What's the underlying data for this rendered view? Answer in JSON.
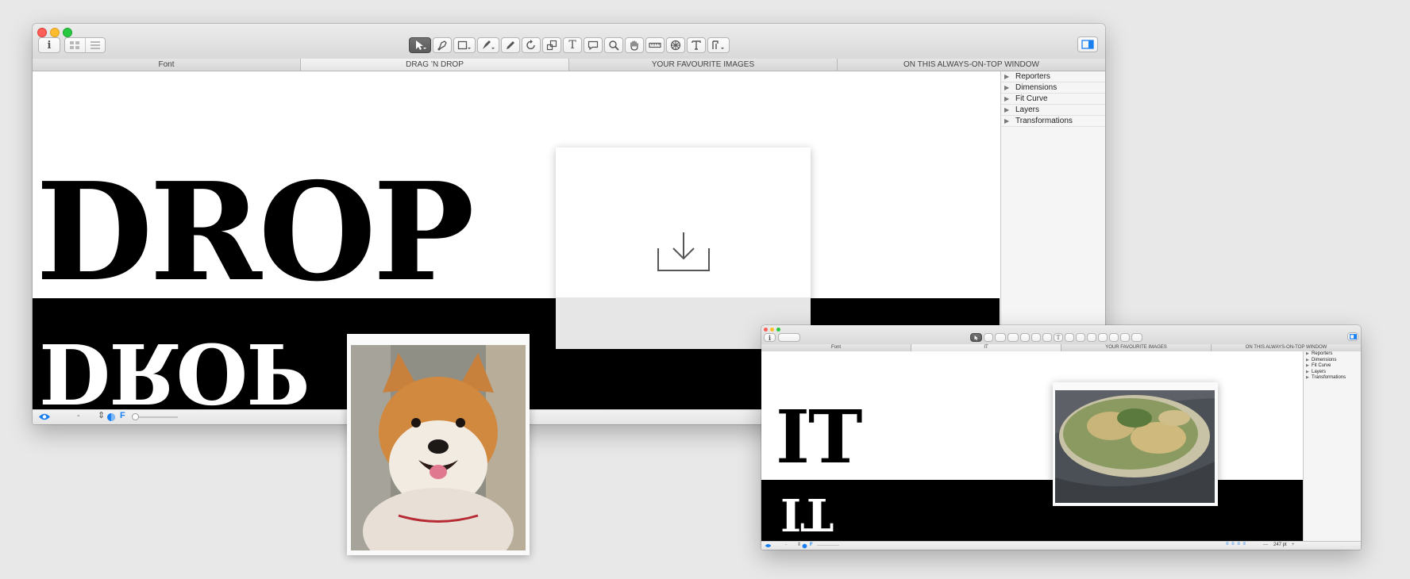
{
  "window_main": {
    "tabs": [
      "Font",
      "DRAG  ’N  DROP",
      "YOUR FAVOURITE IMAGES",
      "ON THIS ALWAYS-ON-TOP WINDOW"
    ],
    "canvas_text": "DROP",
    "canvas_text_mirrored": "DROP",
    "sidebar_items": [
      "Reporters",
      "Dimensions",
      "Fit Curve",
      "Layers",
      "Transformations"
    ],
    "status_dash": "-",
    "status_f": "F"
  },
  "window_small": {
    "tabs": [
      "Font",
      "IT",
      "YOUR FAVOURITE IMAGES",
      "ON THIS ALWAYS-ON-TOP WINDOW"
    ],
    "canvas_text": "IT",
    "canvas_text_mirrored": "IT",
    "sidebar_items": [
      "Reporters",
      "Dimensions",
      "Fit Curve",
      "Layers",
      "Transformations"
    ],
    "status_dash": "-",
    "status_f": "F",
    "status_dash_right": "—",
    "status_size": "247 pt",
    "status_plus": "+"
  },
  "icons": {
    "info": "i",
    "text_tool": "T",
    "accent_color": "#1a7ff0"
  }
}
